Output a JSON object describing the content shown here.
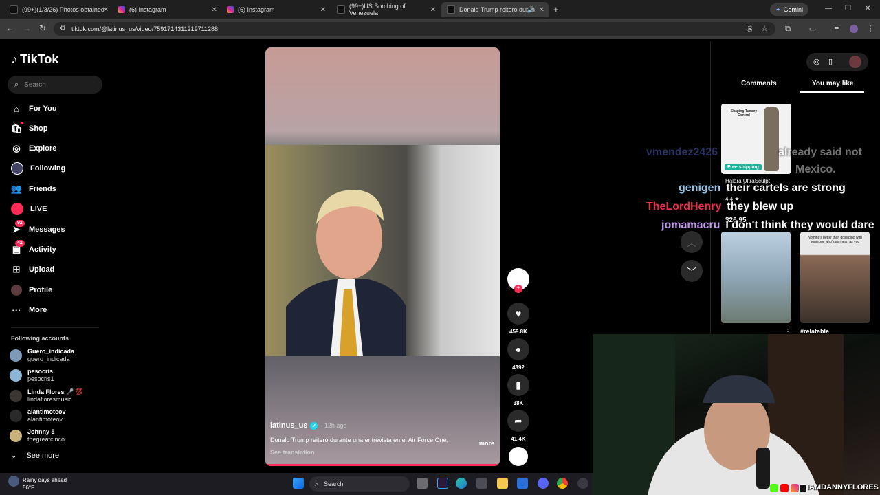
{
  "browser": {
    "tabs": [
      {
        "title": "(99+)(1/3/26) Photos obtained",
        "icon": "tiktok-icon"
      },
      {
        "title": "(6) Instagram",
        "icon": "instagram-icon"
      },
      {
        "title": "(6) Instagram",
        "icon": "instagram-icon"
      },
      {
        "title": "(99+)US Bombing of Venezuela",
        "icon": "tiktok-icon"
      },
      {
        "title": "Donald Trump reiteró duran",
        "icon": "tiktok-icon"
      }
    ],
    "gemini_label": "Gemini",
    "url": "tiktok.com/@latinus_us/video/7591714311219711288"
  },
  "tiktok": {
    "logo_text": "TikTok",
    "search_placeholder": "Search",
    "nav": [
      {
        "label": "For You",
        "icon": "home-icon",
        "badge": ""
      },
      {
        "label": "Shop",
        "icon": "shop-icon",
        "badge": ""
      },
      {
        "label": "Explore",
        "icon": "compass-icon",
        "badge": ""
      },
      {
        "label": "Following",
        "icon": "following-icon",
        "badge": ""
      },
      {
        "label": "Friends",
        "icon": "friends-icon",
        "badge": ""
      },
      {
        "label": "LIVE",
        "icon": "live-icon",
        "badge": ""
      },
      {
        "label": "Messages",
        "icon": "messages-icon",
        "badge": "92"
      },
      {
        "label": "Activity",
        "icon": "activity-icon",
        "badge": "42"
      },
      {
        "label": "Upload",
        "icon": "upload-icon",
        "badge": ""
      },
      {
        "label": "Profile",
        "icon": "profile-icon",
        "badge": ""
      },
      {
        "label": "More",
        "icon": "more-icon",
        "badge": ""
      }
    ],
    "following_title": "Following accounts",
    "accounts": [
      {
        "name": "Guero_indicada",
        "handle": "guero_indicada"
      },
      {
        "name": "pesocris",
        "handle": "pesocris1"
      },
      {
        "name": "Linda Flores 🎤 💯",
        "handle": "lindafloresmusic"
      },
      {
        "name": "alantimoteov",
        "handle": "alantimoteov"
      },
      {
        "name": "Johnny 5",
        "handle": "thegreatcinco"
      }
    ],
    "see_more": "See more"
  },
  "video": {
    "username": "latinus_us",
    "posted": "· 12h ago",
    "description": "Donald Trump reiteró durante una entrevista en el Air Force One,",
    "more_label": "more",
    "see_translation": "See translation",
    "progress": 0.99,
    "likes": "459.8K",
    "comments": "4392",
    "saves": "38K",
    "shares": "41.4K"
  },
  "right_panel": {
    "tab_comments": "Comments",
    "tab_you_may_like": "You may like",
    "product_card_text": "Shaping Tummy Control",
    "free_shipping": "Free shipping",
    "product_name": "Halara UltraSculpt",
    "rating": "4.4 ★ ·",
    "price": "$26.95",
    "card3_overlay": "Nothing's better than gossiping with someone who's as mean as you",
    "hashtag": "#relatable"
  },
  "chat": [
    {
      "user": "vmendez2426",
      "text": "already said not",
      "user_color": "#5b6fd6"
    },
    {
      "user": "",
      "text": "Mexico.",
      "user_color": "#ffffff"
    },
    {
      "user": "genigen",
      "text": "their cartels are strong",
      "user_color": "#9ac6e8"
    },
    {
      "user": "TheLordHenry",
      "text": "they blew up",
      "user_color": "#e8304a"
    },
    {
      "user": "jomamacru",
      "text": "I don't think they would dare",
      "user_color": "#c69af0"
    }
  ],
  "stream": {
    "handle": "IAMDANNYFLORES"
  },
  "taskbar": {
    "weather_title": "Rainy days ahead",
    "weather_temp": "56°F",
    "search_label": "Search"
  },
  "colors": {
    "accent": "#fe2c55",
    "verified": "#20d5ec",
    "shipping": "#20b39d"
  }
}
